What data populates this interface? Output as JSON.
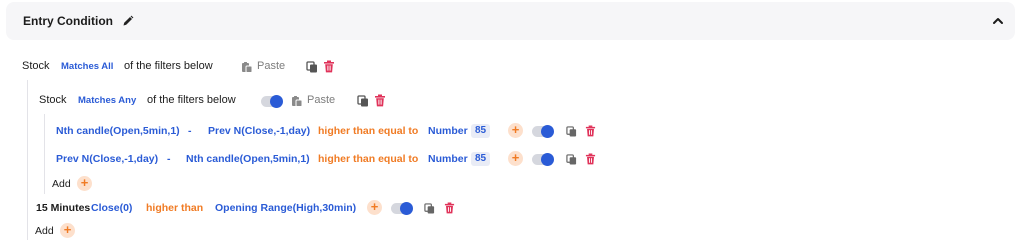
{
  "header": {
    "title": "Entry Condition",
    "edit_icon": "pencil-icon",
    "collapse_icon": "chevron-up-icon"
  },
  "outer_group": {
    "subject": "Stock",
    "match_mode": "Matches All",
    "suffix": "of the filters below",
    "paste_label": "Paste"
  },
  "inner_group": {
    "subject": "Stock",
    "match_mode": "Matches Any",
    "suffix": "of the filters below",
    "paste_label": "Paste",
    "toggle_on": true,
    "conditions": [
      {
        "left": "Nth candle(Open,5min,1)",
        "operator": "-",
        "right": "Prev N(Close,-1,day)",
        "comparator": "higher than equal to",
        "value_type": "Number",
        "value": "85",
        "toggle_on": true
      },
      {
        "left": "Prev N(Close,-1,day)",
        "operator": "-",
        "right": "Nth candle(Open,5min,1)",
        "comparator": "higher than equal to",
        "value_type": "Number",
        "value": "85",
        "toggle_on": true
      }
    ],
    "add_label": "Add"
  },
  "outer_condition": {
    "timeframe": "15 Minutes",
    "left": "Close(0)",
    "comparator": "higher than",
    "right": "Opening Range(High,30min)",
    "toggle_on": true
  },
  "outer_add_label": "Add",
  "colors": {
    "accent_blue": "#2a5bd6",
    "accent_orange": "#f07b24",
    "delete_red": "#e0335a",
    "header_bg": "#f6f6f8"
  }
}
